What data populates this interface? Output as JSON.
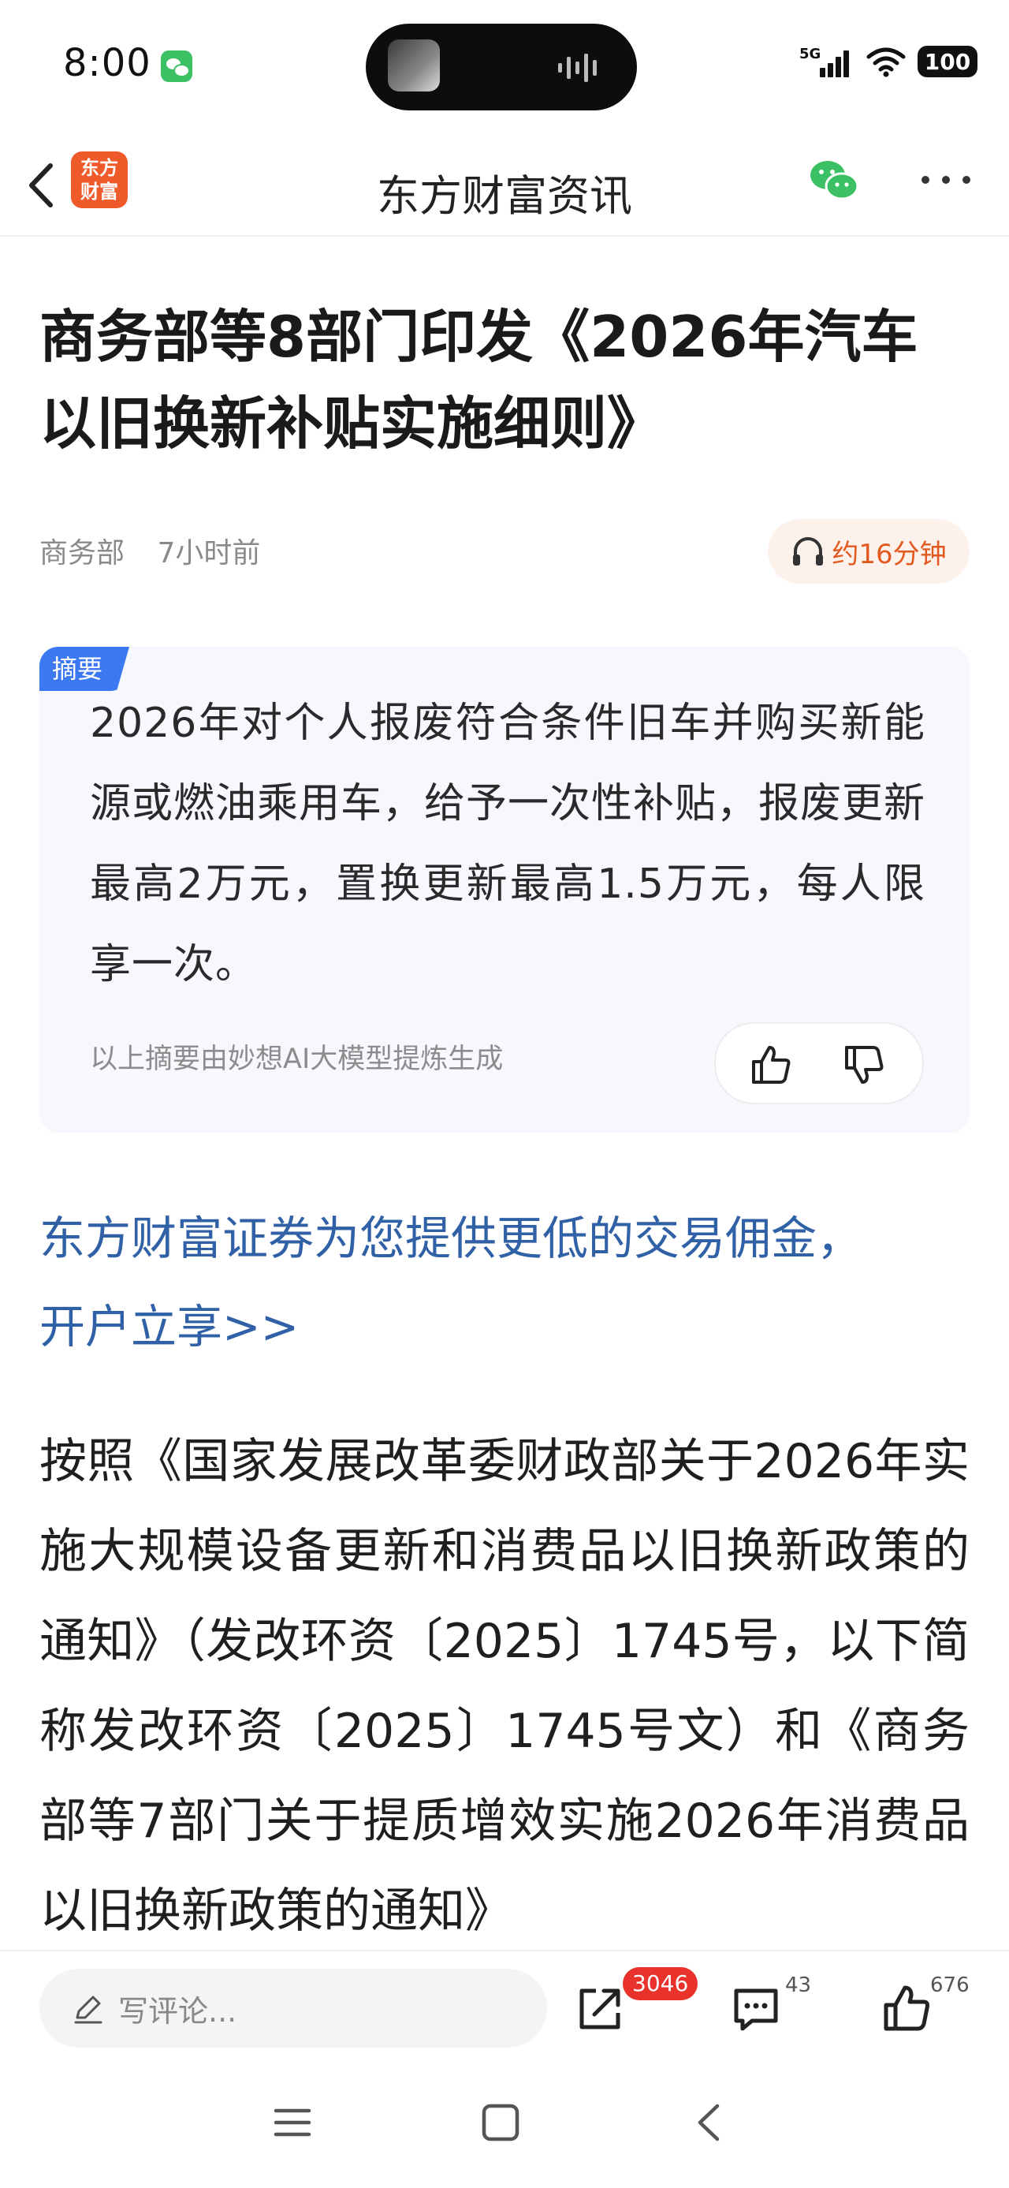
{
  "status_bar": {
    "time": "8:00",
    "network": "5G",
    "battery": "100"
  },
  "nav": {
    "logo_line1": "东方",
    "logo_line2": "财富",
    "title": "东方财富资讯"
  },
  "article": {
    "headline": "商务部等8部门印发《2026年汽车以旧换新补贴实施细则》",
    "source": "商务部",
    "time": "7小时前",
    "read_time": "约16分钟"
  },
  "summary": {
    "tag": "摘要",
    "text": "2026年对个人报废符合条件旧车并购买新能源或燃油乘用车，给予一次性补贴，报废更新最高2万元，置换更新最高1.5万元，每人限享一次。",
    "note": "以上摘要由妙想AI大模型提炼生成"
  },
  "promo": {
    "line1": "东方财富证券为您提供更低的交易佣金，",
    "line2": "开户立享>>"
  },
  "body": {
    "paragraph": "按照《国家发展改革委财政部关于2026年实施大规模设备更新和消费品以旧换新政策的通知》（发改环资〔2025〕1745号，以下简称发改环资〔2025〕1745号文）和《商务部等7部门关于提质增效实施2026年消费品以旧换新政策的通知》"
  },
  "bottom_bar": {
    "comment_placeholder": "写评论...",
    "share_count": "3046",
    "comment_count": "43",
    "like_count": "676"
  },
  "colors": {
    "brand": "#ef5a2a",
    "link": "#3061a6",
    "summary_tag": "#3b78f2",
    "badge": "#e8322b"
  },
  "icons": [
    "wechat-icon",
    "back-icon",
    "wechat-share-icon",
    "more-icon",
    "headphones-icon",
    "thumbs-up-icon",
    "thumbs-down-icon",
    "pen-icon",
    "share-icon",
    "comment-icon",
    "like-icon",
    "menu-icon",
    "home-icon",
    "back-gesture-icon"
  ]
}
